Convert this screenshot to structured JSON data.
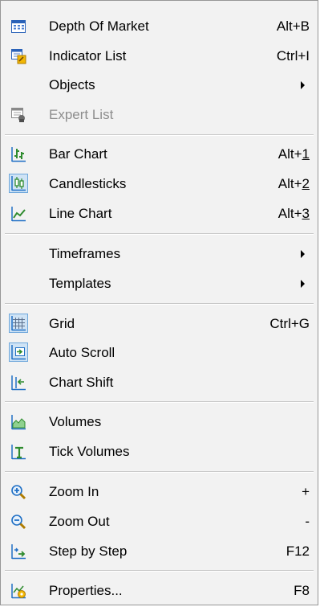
{
  "menu": {
    "depth_of_market": {
      "label": "Depth Of Market",
      "shortcut": "Alt+B"
    },
    "indicator_list": {
      "label": "Indicator List",
      "shortcut": "Ctrl+I"
    },
    "objects": {
      "label": "Objects"
    },
    "expert_list": {
      "label": "Expert List",
      "enabled": false
    },
    "bar_chart": {
      "label": "Bar Chart",
      "shortcut_prefix": "Alt+",
      "shortcut_key": "1"
    },
    "candlesticks": {
      "label": "Candlesticks",
      "shortcut_prefix": "Alt+",
      "shortcut_key": "2",
      "checked": true
    },
    "line_chart": {
      "label": "Line Chart",
      "shortcut_prefix": "Alt+",
      "shortcut_key": "3"
    },
    "timeframes": {
      "label": "Timeframes"
    },
    "templates": {
      "label": "Templates"
    },
    "grid": {
      "label": "Grid",
      "shortcut": "Ctrl+G",
      "checked": true
    },
    "auto_scroll": {
      "label": "Auto Scroll",
      "checked": true
    },
    "chart_shift": {
      "label": "Chart Shift"
    },
    "volumes": {
      "label": "Volumes"
    },
    "tick_volumes": {
      "label": "Tick Volumes"
    },
    "zoom_in": {
      "label": "Zoom In",
      "shortcut": "+"
    },
    "zoom_out": {
      "label": "Zoom Out",
      "shortcut": "-"
    },
    "step_by_step": {
      "label": "Step by Step",
      "shortcut": "F12"
    },
    "properties": {
      "label": "Properties...",
      "shortcut": "F8"
    }
  },
  "colors": {
    "menu_background": "#f2f2f2",
    "checked_highlight": "#cfe3f5",
    "checked_border": "#6fa7db",
    "disabled_text": "#8d8d8d",
    "icon_green": "#2e8b2e",
    "icon_blue": "#1f6fc5"
  }
}
